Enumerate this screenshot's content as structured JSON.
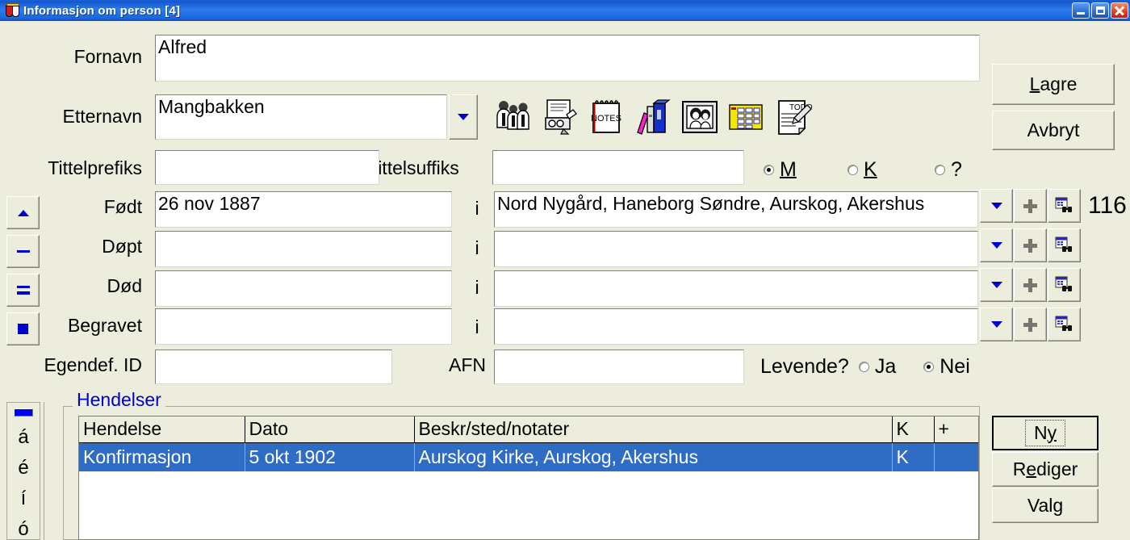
{
  "window": {
    "title": "Informasjon om person  [4]",
    "icon": "shield-icon",
    "buttons": {
      "minimize": "minimize-button",
      "maximize": "maximize-button",
      "close": "close-button"
    }
  },
  "form": {
    "labels": {
      "fornavn": "Fornavn",
      "etternavn": "Etternavn",
      "tittelprefiks": "Tittelprefiks",
      "tittelsuffiks": "Tittelsuffiks",
      "fodt": "Født",
      "dopt": "Døpt",
      "dod": "Død",
      "begravet": "Begravet",
      "egendef_id": "Egendef. ID",
      "afn": "AFN",
      "separator": "i"
    },
    "values": {
      "fornavn": "Alfred",
      "etternavn": "Mangbakken",
      "tittelprefiks": "",
      "tittelsuffiks": "",
      "fodt_dato": "26 nov 1887",
      "fodt_sted": "Nord Nygård, Haneborg Søndre, Aurskog, Akershus",
      "dopt_dato": "",
      "dopt_sted": "",
      "dod_dato": "",
      "dod_sted": "",
      "begravet_dato": "",
      "begravet_sted": "",
      "egendef_id": "",
      "afn": ""
    },
    "gender": {
      "options": [
        {
          "label": "M",
          "accel": "M",
          "selected": true
        },
        {
          "label": "K",
          "accel": "K",
          "selected": false
        },
        {
          "label": "?",
          "accel": "",
          "selected": false
        }
      ]
    },
    "levende": {
      "label": "Levende?",
      "accel": "L",
      "options": [
        {
          "label": "Ja",
          "selected": false
        },
        {
          "label": "Nei",
          "selected": true
        }
      ]
    },
    "record_count": "116"
  },
  "toolbar_icons": [
    "family-group-icon",
    "document-scanner-icon",
    "notes-pad-icon",
    "books-icon",
    "photo-frame-icon",
    "calendar-icon",
    "todo-list-icon"
  ],
  "side_buttons": [
    {
      "name": "move-up-button",
      "glyph": "triangle-up-icon"
    },
    {
      "name": "dash-button",
      "glyph": "dash-icon"
    },
    {
      "name": "lines-button",
      "glyph": "equals-icon"
    },
    {
      "name": "square-button",
      "glyph": "square-icon"
    }
  ],
  "row_buttons": {
    "dropdown": "dropdown-arrow-icon",
    "add": "plus-icon",
    "search": "search-place-icon"
  },
  "actions": {
    "lagre": "Lagre",
    "lagre_accel": "L",
    "avbryt": "Avbryt"
  },
  "events_group": {
    "title": "Hendelser",
    "columns": [
      "Hendelse",
      "Dato",
      "Beskr/sted/notater",
      "K",
      "+"
    ],
    "rows": [
      {
        "hendelse": "Konfirmasjon",
        "dato": "5 okt 1902",
        "beskrivelse": "Aurskog Kirke, Aurskog, Akershus",
        "k": "K",
        "plus": "",
        "selected": true
      }
    ],
    "buttons": [
      {
        "label": "Ny",
        "accel": "y",
        "focused": true
      },
      {
        "label": "Rediger",
        "accel": "e",
        "focused": false
      },
      {
        "label": "Valg",
        "accel": "g",
        "focused": false
      }
    ]
  },
  "char_palette": {
    "color_button": "blue-square-button",
    "chars": [
      "á",
      "é",
      "í",
      "ó"
    ]
  },
  "colors": {
    "background": "#ECEDDC",
    "title_bar": "#1457cf",
    "selection": "#2f6cc4",
    "group_title": "#0000cc",
    "field_bg": "#FFFFFF"
  }
}
